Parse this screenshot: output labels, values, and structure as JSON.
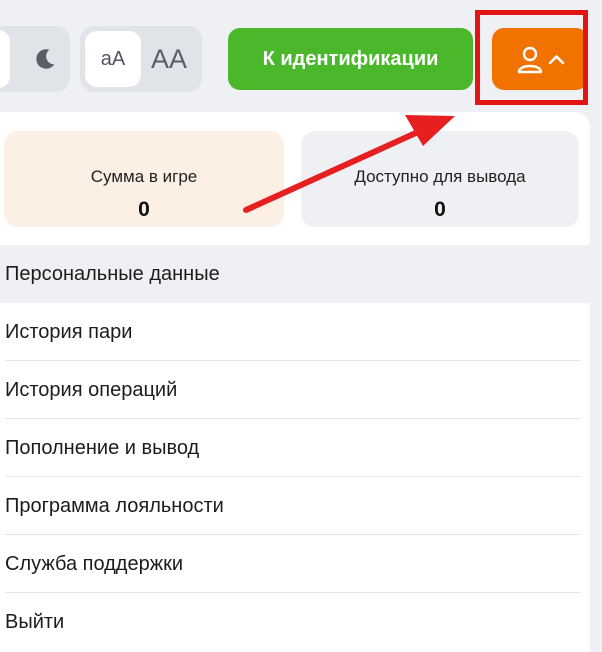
{
  "header": {
    "font_small_label": "aA",
    "font_large_label": "AA",
    "identification_button": "К идентификации"
  },
  "balances": {
    "in_game_label": "Сумма в игре",
    "in_game_value": "0",
    "available_label": "Доступно для вывода",
    "available_value": "0"
  },
  "menu": {
    "items": [
      {
        "label": "Персональные данные"
      },
      {
        "label": "История пари"
      },
      {
        "label": "История операций"
      },
      {
        "label": "Пополнение и вывод"
      },
      {
        "label": "Программа лояльности"
      },
      {
        "label": "Служба поддержки"
      },
      {
        "label": "Выйти"
      }
    ]
  },
  "colors": {
    "accent_green": "#4ab82a",
    "accent_orange": "#f27200",
    "highlight_red": "#e21414"
  }
}
